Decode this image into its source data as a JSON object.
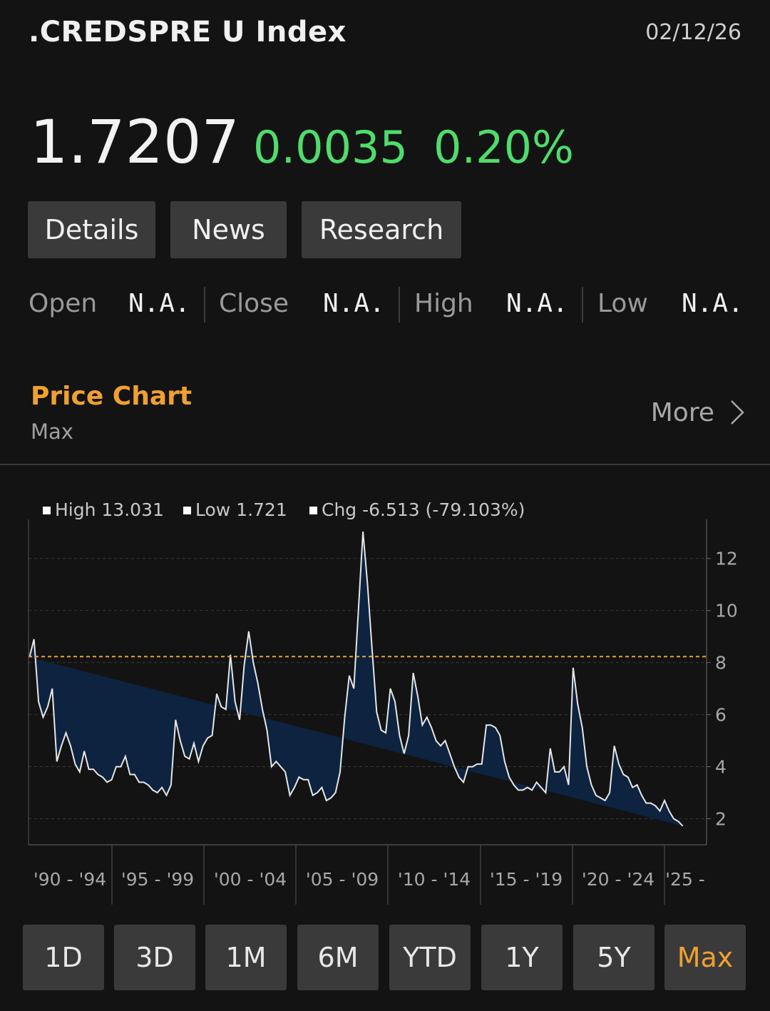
{
  "header": {
    "ticker": ".CREDSPRE U Index",
    "date": "02/12/26"
  },
  "quote": {
    "last": "1.7207",
    "change": "0.0035",
    "change_pct": "0.20%",
    "change_color": "#4fdc6b"
  },
  "tabs": [
    "Details",
    "News",
    "Research"
  ],
  "stats": [
    {
      "label": "Open",
      "value": "N.A."
    },
    {
      "label": "Close",
      "value": "N.A."
    },
    {
      "label": "High",
      "value": "N.A."
    },
    {
      "label": "Low",
      "value": "N.A."
    }
  ],
  "price_chart": {
    "title": "Price Chart",
    "range_label": "Max",
    "more_label": "More"
  },
  "legend": {
    "high": "High 13.031",
    "low": "Low 1.721",
    "chg": "Chg -6.513 (-79.103%)"
  },
  "range_buttons": [
    "1D",
    "3D",
    "1M",
    "6M",
    "YTD",
    "1Y",
    "5Y",
    "Max"
  ],
  "active_range": "Max",
  "accent_color": "#f0a030",
  "chart_data": {
    "type": "area",
    "y_ticks": [
      2,
      4,
      6,
      8,
      10,
      12
    ],
    "ylim": [
      1,
      13.5
    ],
    "reference_line": 8.23,
    "x_tick_labels": [
      "'90 - '94",
      "'95 - '99",
      "'00 - '04",
      "'05 - '09",
      "'10 - '14",
      "'15 - '19",
      "'20 - '24",
      "'25 -"
    ],
    "xlim": [
      1989.9,
      2027.0
    ],
    "grid": true,
    "x": [
      1989.95,
      1990.2,
      1990.45,
      1990.7,
      1990.95,
      1991.2,
      1991.45,
      1991.7,
      1991.95,
      1992.2,
      1992.45,
      1992.7,
      1992.95,
      1993.2,
      1993.45,
      1993.7,
      1993.95,
      1994.2,
      1994.45,
      1994.7,
      1994.95,
      1995.2,
      1995.45,
      1995.7,
      1995.95,
      1996.2,
      1996.45,
      1996.7,
      1996.95,
      1997.2,
      1997.45,
      1997.7,
      1997.95,
      1998.2,
      1998.45,
      1998.7,
      1998.95,
      1999.2,
      1999.45,
      1999.7,
      1999.95,
      2000.2,
      2000.45,
      2000.7,
      2000.95,
      2001.2,
      2001.45,
      2001.7,
      2001.95,
      2002.2,
      2002.45,
      2002.7,
      2002.95,
      2003.2,
      2003.45,
      2003.7,
      2003.95,
      2004.2,
      2004.45,
      2004.7,
      2004.95,
      2005.2,
      2005.45,
      2005.7,
      2005.95,
      2006.2,
      2006.45,
      2006.7,
      2006.95,
      2007.2,
      2007.45,
      2007.7,
      2007.95,
      2008.2,
      2008.45,
      2008.7,
      2008.95,
      2009.2,
      2009.45,
      2009.7,
      2009.95,
      2010.2,
      2010.45,
      2010.7,
      2010.95,
      2011.2,
      2011.45,
      2011.7,
      2011.95,
      2012.2,
      2012.45,
      2012.7,
      2012.95,
      2013.2,
      2013.45,
      2013.7,
      2013.95,
      2014.2,
      2014.45,
      2014.7,
      2014.95,
      2015.2,
      2015.45,
      2015.7,
      2015.95,
      2016.2,
      2016.45,
      2016.7,
      2016.95,
      2017.2,
      2017.45,
      2017.7,
      2017.95,
      2018.2,
      2018.45,
      2018.7,
      2018.95,
      2019.2,
      2019.45,
      2019.7,
      2019.95,
      2020.2,
      2020.45,
      2020.7,
      2020.95,
      2021.2,
      2021.45,
      2021.7,
      2021.95,
      2022.2,
      2022.45,
      2022.7,
      2022.95,
      2023.2,
      2023.45,
      2023.7,
      2023.95,
      2024.2,
      2024.45,
      2024.7,
      2024.95,
      2025.2,
      2025.45,
      2025.7,
      2025.95,
      2026.1
    ],
    "values": [
      8.2,
      8.9,
      6.5,
      5.9,
      6.3,
      7.0,
      4.2,
      4.8,
      5.3,
      4.8,
      4.1,
      3.8,
      4.6,
      3.9,
      3.9,
      3.7,
      3.6,
      3.4,
      3.5,
      4.0,
      4.0,
      4.4,
      3.7,
      3.7,
      3.4,
      3.4,
      3.3,
      3.1,
      3.0,
      3.2,
      2.9,
      3.3,
      5.8,
      5.0,
      4.4,
      4.3,
      4.9,
      4.2,
      4.8,
      5.1,
      5.2,
      6.8,
      6.3,
      6.2,
      8.3,
      6.5,
      5.8,
      7.9,
      9.2,
      8.0,
      7.2,
      6.2,
      5.4,
      4.0,
      4.2,
      4.0,
      3.8,
      2.9,
      3.2,
      3.6,
      3.5,
      3.5,
      2.9,
      3.0,
      3.2,
      2.7,
      2.8,
      3.0,
      3.8,
      5.9,
      7.5,
      7.0,
      10.0,
      13.031,
      11.0,
      8.5,
      6.1,
      5.4,
      5.3,
      7.0,
      6.5,
      5.2,
      4.5,
      5.2,
      7.6,
      6.7,
      5.6,
      5.9,
      5.5,
      5.0,
      4.8,
      5.0,
      4.5,
      4.0,
      3.6,
      3.4,
      4.0,
      4.0,
      4.1,
      4.1,
      5.6,
      5.6,
      5.5,
      5.2,
      4.2,
      3.6,
      3.3,
      3.1,
      3.1,
      3.2,
      3.1,
      3.4,
      3.2,
      3.0,
      4.7,
      3.8,
      3.8,
      4.0,
      3.3,
      7.8,
      6.4,
      5.5,
      4.0,
      3.3,
      2.9,
      2.8,
      2.7,
      3.0,
      4.8,
      4.1,
      3.7,
      3.6,
      3.2,
      3.3,
      2.9,
      2.6,
      2.6,
      2.5,
      2.3,
      2.7,
      2.3,
      2.0,
      1.9,
      1.721
    ]
  }
}
